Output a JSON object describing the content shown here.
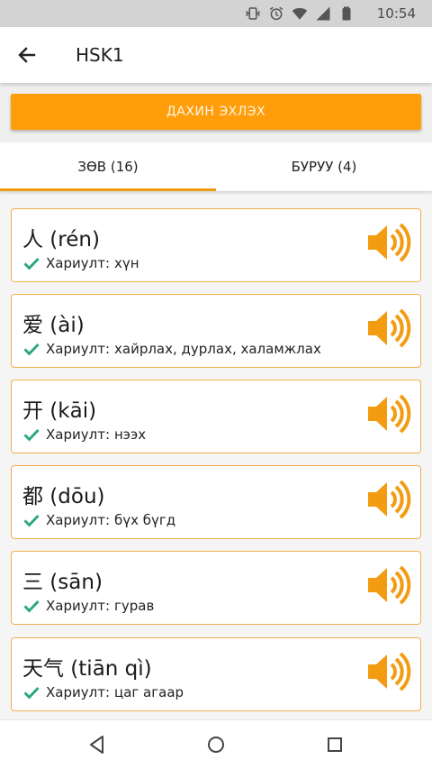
{
  "status_bar": {
    "time": "10:54",
    "icons": [
      "vibrate-icon",
      "alarm-icon",
      "wifi-icon",
      "signal-icon",
      "battery-icon"
    ]
  },
  "app_bar": {
    "back_icon": "arrow-left-icon",
    "title": "HSK1"
  },
  "restart_button": {
    "label": "ДАХИН ЭХЛЭХ",
    "color": "#ff9e0a"
  },
  "tabs": [
    {
      "label": "ЗӨВ (16)",
      "selected": true
    },
    {
      "label": "БУРУУ (4)",
      "selected": false
    }
  ],
  "colors": {
    "accent": "#f39c12",
    "check": "#2aa876",
    "card_border": "#f1b04c"
  },
  "answer_prefix": "Хариулт:",
  "items": [
    {
      "word": "人 (rén)",
      "answer": "хүн"
    },
    {
      "word": "爱 (ài)",
      "answer": "хайрлах, дурлах, халамжлах"
    },
    {
      "word": "开 (kāi)",
      "answer": "нээх"
    },
    {
      "word": "都 (dōu)",
      "answer": "бүх бүгд"
    },
    {
      "word": "三 (sān)",
      "answer": "гурав"
    },
    {
      "word": "天气 (tiān qì)",
      "answer": "цаг агаар"
    }
  ],
  "nav_bar": {
    "icons": [
      "back-triangle-icon",
      "home-circle-icon",
      "recents-square-icon"
    ]
  }
}
